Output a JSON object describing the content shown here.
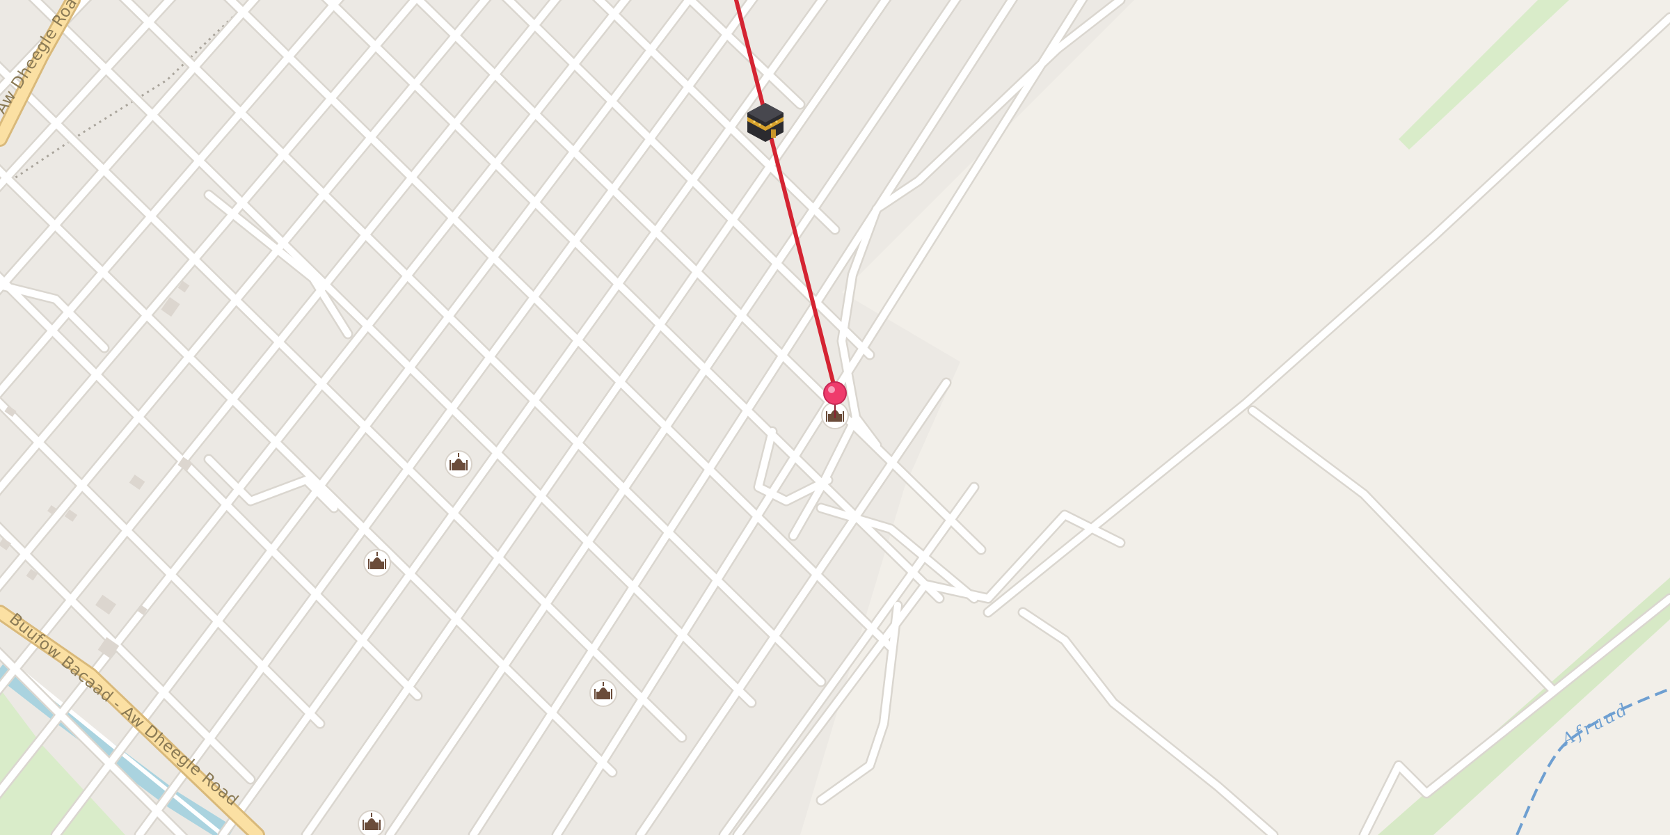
{
  "map": {
    "road_labels": {
      "primary": "Buufow Bacaad - Aw Dheegle Road",
      "primary_top": "Aw Dheegle Road"
    },
    "water_labels": {
      "stream": "Afraad"
    },
    "colors": {
      "land": "#f2efe9",
      "urban": "#ece9e4",
      "road_fill": "#ffffff",
      "road_casing": "#dad6cf",
      "primary_road": "#fbe0a3",
      "primary_casing": "#d9b97a",
      "river": "#aad3df",
      "stream": "#6e9fd1",
      "green": "#cfe7bd",
      "route": "#d42432",
      "pin": "#ef3b6c",
      "poi_icon": "#6b4c3a"
    },
    "markers": {
      "destination": "kaaba-icon",
      "pin": "map-pin-icon",
      "poi": "place-of-worship-icon"
    }
  }
}
